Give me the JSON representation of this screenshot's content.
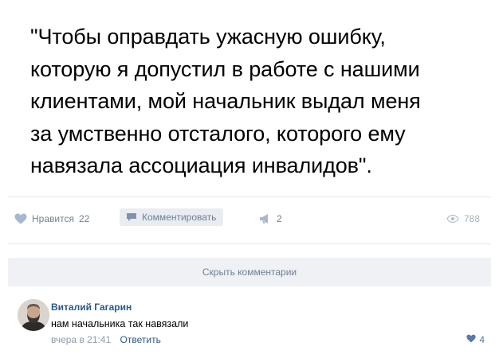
{
  "post": {
    "text_lines": [
      "\"Чтобы оправдать ужасную ошибку,",
      "которую я допустил в работе с нашими",
      "клиентами, мой начальник выдал меня",
      "за умственно отсталого, которого ему",
      "навязала ассоциация инвалидов\"."
    ]
  },
  "actions": {
    "like_label": "Нравится",
    "like_count": "22",
    "comment_label": "Комментировать",
    "share_count": "2",
    "views_count": "788"
  },
  "comments_toggle": {
    "label": "Скрыть комментарии"
  },
  "comment": {
    "author": "Виталий Гагарин",
    "text": "нам начальника так навязали",
    "time": "вчера в 21:41",
    "reply_label": "Ответить",
    "likes": "4"
  },
  "colors": {
    "link": "#2a5885",
    "muted": "#6f7f94",
    "separator": "#e7e8ec",
    "button_bg": "#eff1f4"
  },
  "icons": [
    "heart-icon",
    "comment-icon",
    "megaphone-icon",
    "eye-icon",
    "heart-small-icon"
  ]
}
